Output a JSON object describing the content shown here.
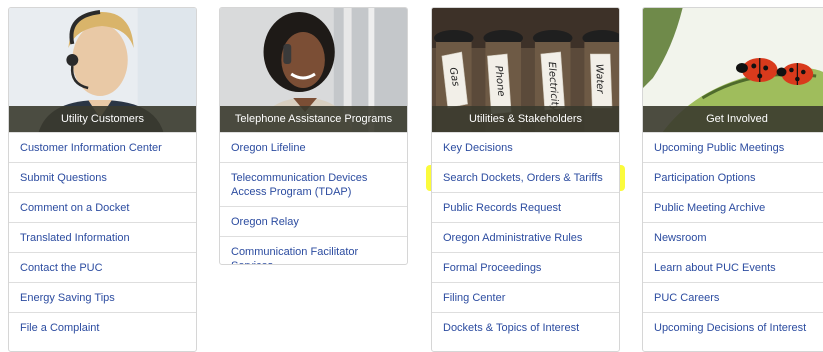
{
  "cards": [
    {
      "title": "Utility Customers",
      "links": [
        "Customer Information Center",
        "Submit Questions",
        "Comment on a Docket",
        "Translated Information",
        "Contact the PUC",
        "Energy Saving Tips",
        "File a Complaint"
      ]
    },
    {
      "title": "Telephone Assistance Programs",
      "links": [
        "Oregon Lifeline",
        "Telecommunication Devices Access Program (TDAP)",
        "Oregon Relay",
        "Communication Facilitator Services"
      ]
    },
    {
      "title": "Utilities & Stakeholders",
      "jar_labels": [
        "Gas",
        "Phone",
        "Electricity",
        "Water"
      ],
      "links": [
        "Key Decisions",
        "Search Dockets, Orders & Tariffs",
        "Public Records Request",
        "Oregon Administrative Rules",
        "Formal Proceedings",
        "Filing Center",
        "Dockets & Topics of Interest"
      ]
    },
    {
      "title": "Get Involved",
      "links": [
        "Upcoming Public Meetings",
        "Participation Options",
        "Public Meeting Archive",
        "Newsroom",
        "Learn about PUC Events",
        "PUC Careers",
        "Upcoming Decisions of Interest"
      ]
    }
  ],
  "colors": {
    "link": "#2c4ca0",
    "caption_bg": "#3a3a2e",
    "highlight": "#fbfb3c",
    "border": "#d6d6d6"
  }
}
